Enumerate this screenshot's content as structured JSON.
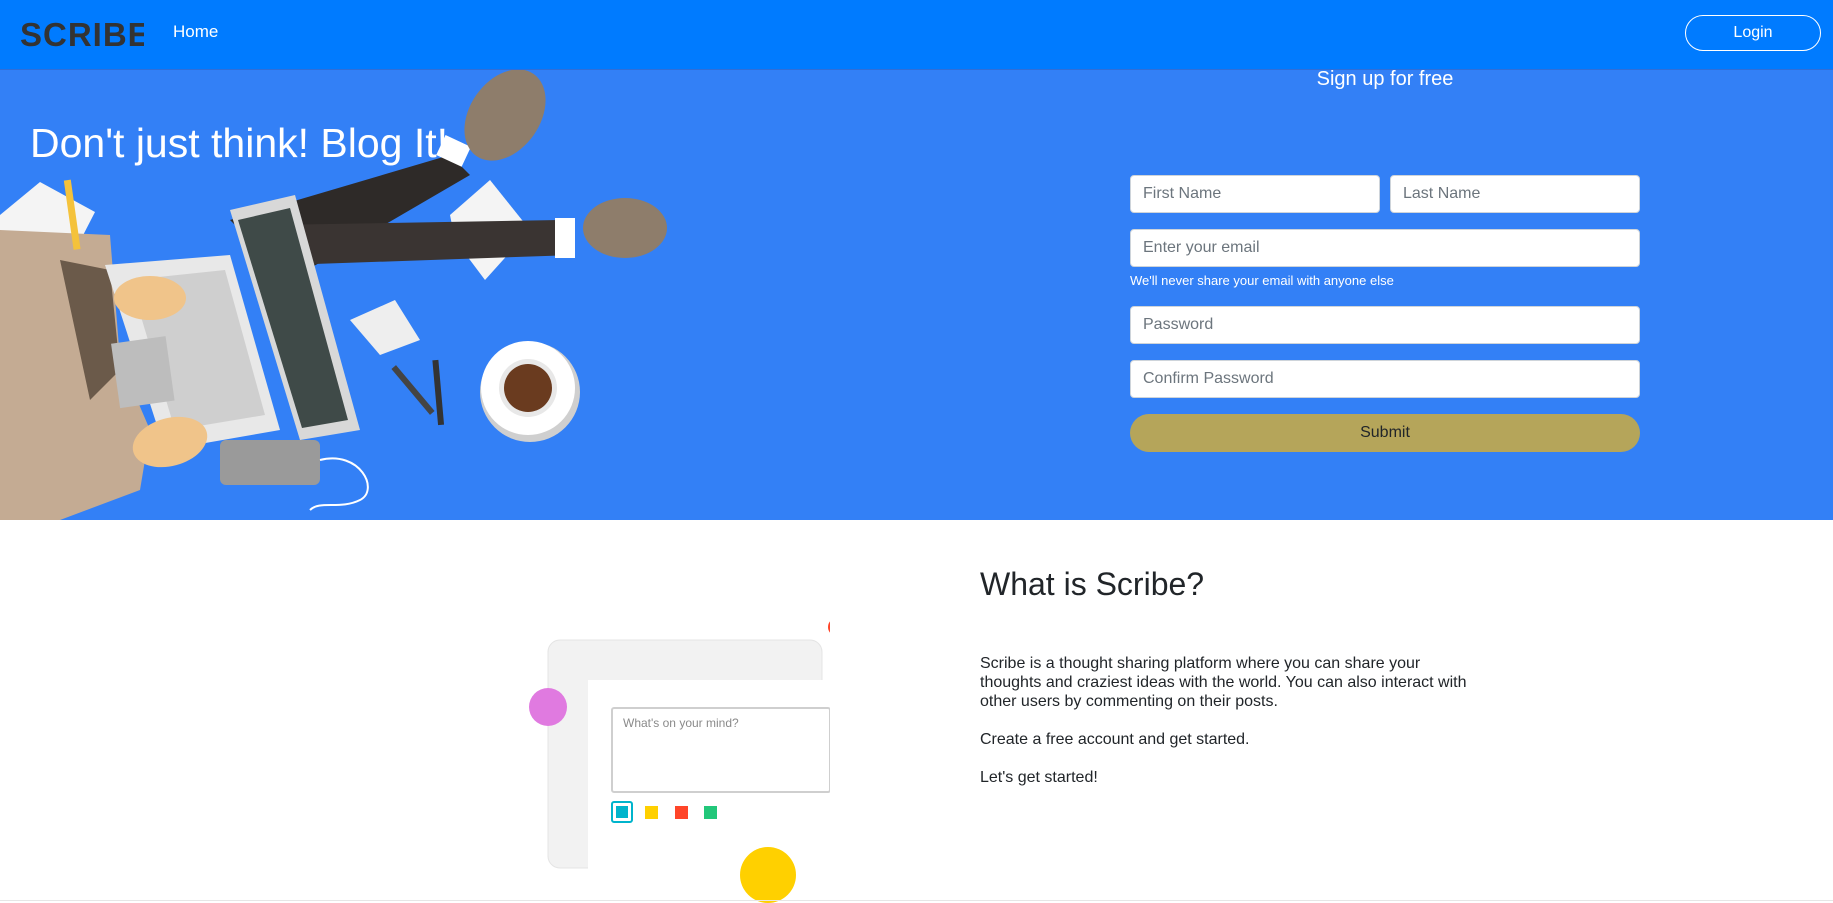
{
  "nav": {
    "logo_text": "SCRIBE",
    "home_label": "Home",
    "login_label": "Login",
    "bar_color": "#007bff"
  },
  "hero": {
    "tagline": "Don't just think! Blog It!",
    "background_color": "#3380f6"
  },
  "signup": {
    "title": "Sign up for free",
    "first_name_placeholder": "First Name",
    "last_name_placeholder": "Last Name",
    "email_placeholder": "Enter your email",
    "email_hint": "We'll never share your email with anyone else",
    "password_placeholder": "Password",
    "confirm_password_placeholder": "Confirm Password",
    "submit_label": "Submit",
    "submit_color": "#b5a55a"
  },
  "about": {
    "title": "What is Scribe?",
    "paragraphs": [
      "Scribe is a thought sharing platform where you can share your thoughts and craziest ideas with the world. You can also interact with other users by commenting on their posts.",
      "Create a free account and get started.",
      "Let's get started!"
    ],
    "mock_input_placeholder": "What's on your mind?",
    "mock_color_swatches": [
      "#00b4cc",
      "#ffd000",
      "#ff4529",
      "#22c77a"
    ]
  }
}
